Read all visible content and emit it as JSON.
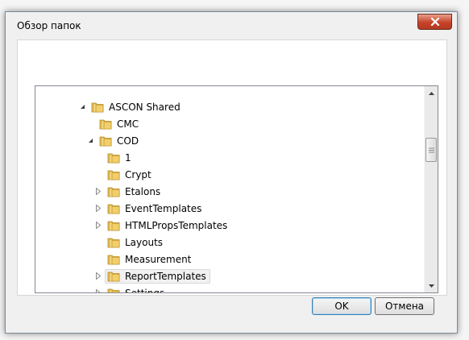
{
  "dialog": {
    "title": "Обзор папок",
    "ok_label": "OK",
    "cancel_label": "Отмена"
  },
  "tree": {
    "items": [
      {
        "label": "ASCON Shared",
        "level": 0,
        "expander": "expanded"
      },
      {
        "label": "CMC",
        "level": 1,
        "expander": "none"
      },
      {
        "label": "COD",
        "level": 1,
        "expander": "expanded"
      },
      {
        "label": "1",
        "level": 2,
        "expander": "none"
      },
      {
        "label": "Crypt",
        "level": 2,
        "expander": "none"
      },
      {
        "label": "Etalons",
        "level": 2,
        "expander": "collapsed"
      },
      {
        "label": "EventTemplates",
        "level": 2,
        "expander": "collapsed"
      },
      {
        "label": "HTMLPropsTemplates",
        "level": 2,
        "expander": "collapsed"
      },
      {
        "label": "Layouts",
        "level": 2,
        "expander": "none"
      },
      {
        "label": "Measurement",
        "level": 2,
        "expander": "none"
      },
      {
        "label": "ReportTemplates",
        "level": 2,
        "expander": "collapsed",
        "selected": true
      },
      {
        "label": "Settings",
        "level": 2,
        "expander": "collapsed"
      }
    ]
  },
  "colors": {
    "folder": "#e8c25a",
    "close_button": "#c7432a"
  }
}
